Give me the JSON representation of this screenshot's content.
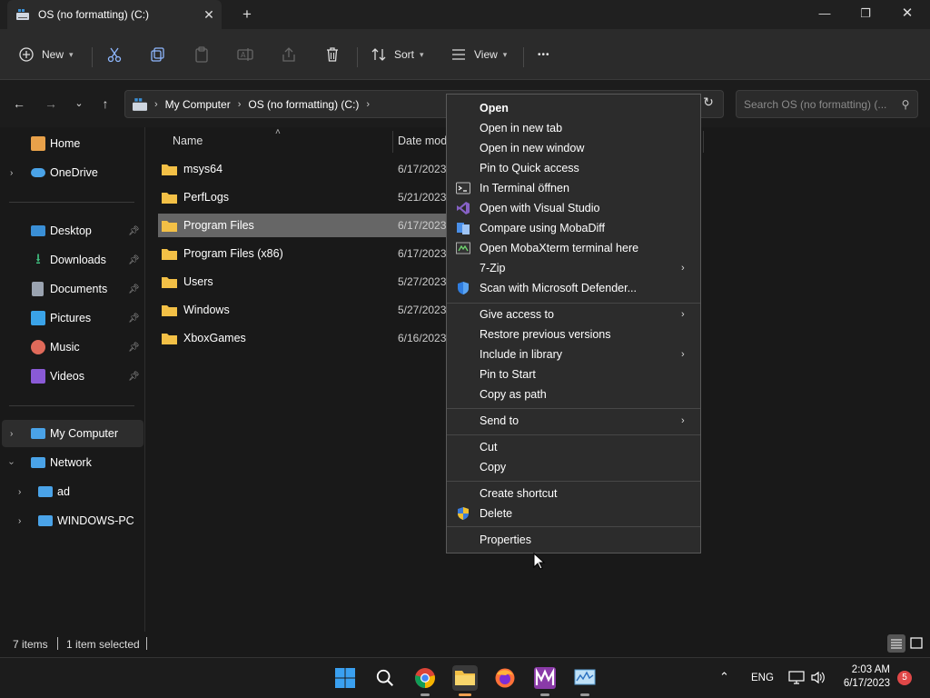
{
  "window": {
    "tab_title": "OS (no formatting) (C:)",
    "close_tab": "✕",
    "new_tab": "+",
    "minimize": "—",
    "maximize": "❐",
    "close": "✕"
  },
  "toolbar": {
    "new_label": "New",
    "sort_label": "Sort",
    "view_label": "View",
    "more_label": "•••"
  },
  "address": {
    "crumbs": [
      "My Computer",
      "OS (no formatting) (C:)"
    ],
    "search_placeholder": "Search OS (no formatting) (..."
  },
  "sidebar": {
    "items": [
      {
        "label": "Home",
        "icon": "home-icon",
        "color": "#e8a14a"
      },
      {
        "label": "OneDrive",
        "icon": "cloud-icon",
        "color": "#4aa3e8"
      },
      {
        "label": "Desktop",
        "icon": "desktop-icon",
        "color": "#3a8fd6"
      },
      {
        "label": "Downloads",
        "icon": "download-icon",
        "color": "#3fbf7f"
      },
      {
        "label": "Documents",
        "icon": "document-icon",
        "color": "#9aa3b0"
      },
      {
        "label": "Pictures",
        "icon": "pictures-icon",
        "color": "#3aa3e8"
      },
      {
        "label": "Music",
        "icon": "music-icon",
        "color": "#e06a5a"
      },
      {
        "label": "Videos",
        "icon": "video-icon",
        "color": "#8a5ad6"
      },
      {
        "label": "My Computer",
        "icon": "computer-icon",
        "color": "#4aa3e8"
      },
      {
        "label": "Network",
        "icon": "network-icon",
        "color": "#4aa3e8"
      },
      {
        "label": "ad",
        "icon": "computer-icon",
        "color": "#4aa3e8"
      },
      {
        "label": "WINDOWS-PC",
        "icon": "computer-icon",
        "color": "#4aa3e8"
      }
    ]
  },
  "filelist": {
    "columns": [
      "Name",
      "Date mod"
    ],
    "rows": [
      {
        "name": "msys64",
        "date": "6/17/2023"
      },
      {
        "name": "PerfLogs",
        "date": "5/21/2023"
      },
      {
        "name": "Program Files",
        "date": "6/17/2023",
        "selected": true
      },
      {
        "name": "Program Files (x86)",
        "date": "6/17/2023"
      },
      {
        "name": "Users",
        "date": "5/27/2023"
      },
      {
        "name": "Windows",
        "date": "5/27/2023"
      },
      {
        "name": "XboxGames",
        "date": "6/16/2023"
      }
    ]
  },
  "status": {
    "items_count": "7 items",
    "selection": "1 item selected"
  },
  "context_menu": {
    "items": [
      {
        "label": "Open",
        "bold": true
      },
      {
        "label": "Open in new tab"
      },
      {
        "label": "Open in new window"
      },
      {
        "label": "Pin to Quick access"
      },
      {
        "label": "In Terminal öffnen",
        "icon": "terminal-icon"
      },
      {
        "label": "Open with Visual Studio",
        "icon": "visual-studio-icon"
      },
      {
        "label": "Compare using MobaDiff",
        "icon": "mobadiff-icon"
      },
      {
        "label": "Open MobaXterm terminal here",
        "icon": "mobaxterm-icon"
      },
      {
        "label": "7-Zip",
        "submenu": true
      },
      {
        "label": "Scan with Microsoft Defender...",
        "icon": "defender-shield-icon"
      },
      {
        "label": "Give access to",
        "submenu": true
      },
      {
        "label": "Restore previous versions"
      },
      {
        "label": "Include in library",
        "submenu": true
      },
      {
        "label": "Pin to Start"
      },
      {
        "label": "Copy as path"
      },
      {
        "label": "Send to",
        "submenu": true
      },
      {
        "label": "Cut"
      },
      {
        "label": "Copy"
      },
      {
        "label": "Create shortcut"
      },
      {
        "label": "Delete",
        "icon": "uac-shield-icon"
      },
      {
        "label": "Properties"
      }
    ]
  },
  "taskbar": {
    "language": "ENG",
    "time": "2:03 AM",
    "date": "6/17/2023",
    "notifications": "5"
  }
}
